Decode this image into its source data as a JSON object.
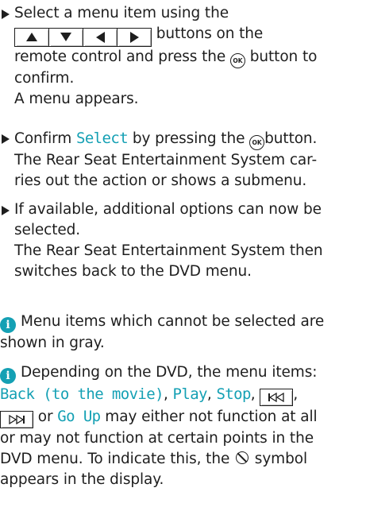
{
  "step1": {
    "line1": "Select a menu item using the",
    "buttons_suffix": "buttons on the",
    "line3a": "remote control and press the",
    "ok_label": "OK",
    "line3b": "button to",
    "line4": "confirm.",
    "result": "A menu appears."
  },
  "step2": {
    "prefix": "Confirm",
    "select_label": "Select",
    "suffix_a": "by pressing the",
    "ok_label": "OK",
    "suffix_b": "button.",
    "result1": "The Rear Seat Entertainment System car-",
    "result2": "ries out the action or shows a submenu."
  },
  "step3": {
    "line1": "If available, additional options can now be",
    "line2": "selected.",
    "result1": "The Rear Seat Entertainment System then",
    "result2": "switches back to the DVD menu."
  },
  "note1": {
    "line1": "Menu items which cannot be selected are",
    "line2": "shown in gray."
  },
  "note2": {
    "line1": "Depending on the DVD, the menu items:",
    "item_back": "Back (to the movie)",
    "item_play": "Play",
    "item_stop": "Stop",
    "sep": ",",
    "text_or": "or",
    "item_goup": "Go Up",
    "line3_tail": "may either not function at all",
    "line4": "or may not function at certain points in the",
    "line5a": "DVD menu. To indicate this, the",
    "line5b": "symbol",
    "line6": "appears in the display."
  },
  "colors": {
    "accent": "#14a0b4",
    "text": "#1e1e1e"
  },
  "icons": {
    "bullet": "triangle-right-bullet",
    "info": "info-circle-icon",
    "ok": "ok-button-icon",
    "prohibited": "prohibited-symbol-icon",
    "prev": "skip-back-icon",
    "next": "skip-forward-icon"
  }
}
